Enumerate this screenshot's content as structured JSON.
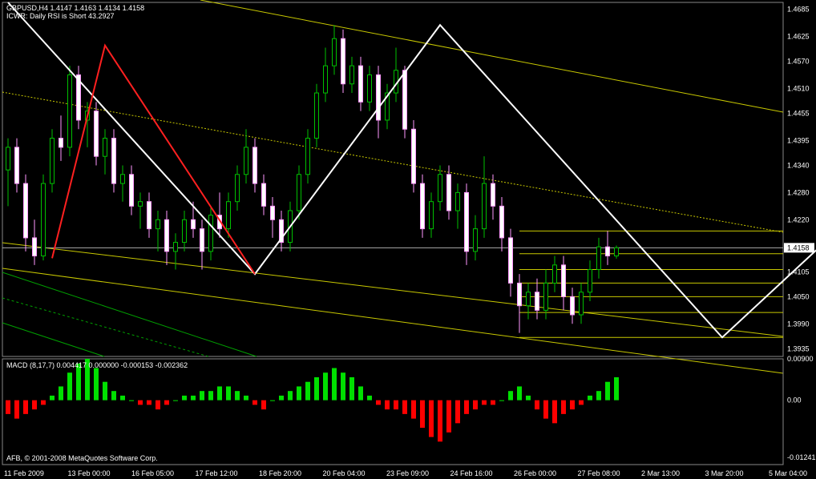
{
  "chart_data": {
    "type": "candlestick",
    "header": {
      "symbol_line": "GBPUSD,H4  1.4147 1.4163 1.4134 1.4158",
      "indicator_line": "ICWR: Daily RSI is Short 43.2927"
    },
    "price_axis": {
      "ylim": [
        1.3918,
        1.47
      ],
      "ticks": [
        "1.4685",
        "1.4625",
        "1.4570",
        "1.4510",
        "1.4455",
        "1.4395",
        "1.4340",
        "1.4280",
        "1.4220",
        "1.4158",
        "1.4105",
        "1.4050",
        "1.3990",
        "1.3935"
      ],
      "current_price": "1.4158"
    },
    "time_axis": {
      "labels": [
        "11 Feb 2009",
        "13 Feb 00:00",
        "16 Feb 05:00",
        "17 Feb 12:00",
        "18 Feb 20:00",
        "20 Feb 04:00",
        "23 Feb 09:00",
        "24 Feb 16:00",
        "26 Feb 00:00",
        "27 Feb 08:00",
        "2 Mar 13:00",
        "3 Mar 20:00",
        "5 Mar 04:00"
      ]
    },
    "zigzag_white": [
      [
        1.47,
        0
      ],
      [
        1.41,
        28
      ],
      [
        1.465,
        49
      ],
      [
        1.396,
        81
      ],
      [
        1.4195,
        94
      ]
    ],
    "zigzag_red": [
      [
        1.4135,
        5
      ],
      [
        1.4605,
        11
      ],
      [
        1.41,
        28
      ]
    ],
    "fib_levels": [
      1.4195,
      1.4145,
      1.411,
      1.408,
      1.405,
      1.4015,
      1.396
    ],
    "candles": [
      [
        1.433,
        1.438,
        1.425,
        1.44
      ],
      [
        1.438,
        1.43,
        1.428,
        1.44
      ],
      [
        1.43,
        1.418,
        1.415,
        1.432
      ],
      [
        1.418,
        1.414,
        1.412,
        1.422
      ],
      [
        1.414,
        1.43,
        1.413,
        1.432
      ],
      [
        1.43,
        1.44,
        1.428,
        1.442
      ],
      [
        1.44,
        1.438,
        1.435,
        1.445
      ],
      [
        1.438,
        1.454,
        1.436,
        1.456
      ],
      [
        1.454,
        1.444,
        1.442,
        1.456
      ],
      [
        1.444,
        1.446,
        1.438,
        1.448
      ],
      [
        1.446,
        1.436,
        1.434,
        1.448
      ],
      [
        1.436,
        1.44,
        1.432,
        1.442
      ],
      [
        1.44,
        1.43,
        1.428,
        1.442
      ],
      [
        1.43,
        1.432,
        1.426,
        1.434
      ],
      [
        1.432,
        1.425,
        1.423,
        1.434
      ],
      [
        1.425,
        1.426,
        1.42,
        1.428
      ],
      [
        1.426,
        1.42,
        1.418,
        1.428
      ],
      [
        1.42,
        1.422,
        1.415,
        1.424
      ],
      [
        1.422,
        1.415,
        1.412,
        1.424
      ],
      [
        1.415,
        1.417,
        1.411,
        1.419
      ],
      [
        1.417,
        1.422,
        1.415,
        1.424
      ],
      [
        1.422,
        1.42,
        1.418,
        1.426
      ],
      [
        1.42,
        1.415,
        1.411,
        1.422
      ],
      [
        1.415,
        1.423,
        1.413,
        1.425
      ],
      [
        1.423,
        1.42,
        1.418,
        1.428
      ],
      [
        1.42,
        1.426,
        1.418,
        1.428
      ],
      [
        1.426,
        1.432,
        1.424,
        1.434
      ],
      [
        1.432,
        1.438,
        1.43,
        1.442
      ],
      [
        1.438,
        1.43,
        1.428,
        1.44
      ],
      [
        1.43,
        1.425,
        1.423,
        1.432
      ],
      [
        1.425,
        1.422,
        1.418,
        1.427
      ],
      [
        1.422,
        1.417,
        1.415,
        1.424
      ],
      [
        1.417,
        1.424,
        1.415,
        1.426
      ],
      [
        1.424,
        1.432,
        1.422,
        1.434
      ],
      [
        1.432,
        1.44,
        1.43,
        1.442
      ],
      [
        1.44,
        1.45,
        1.438,
        1.452
      ],
      [
        1.45,
        1.456,
        1.448,
        1.46
      ],
      [
        1.456,
        1.462,
        1.454,
        1.465
      ],
      [
        1.462,
        1.452,
        1.45,
        1.464
      ],
      [
        1.452,
        1.456,
        1.45,
        1.458
      ],
      [
        1.456,
        1.448,
        1.446,
        1.458
      ],
      [
        1.448,
        1.454,
        1.446,
        1.456
      ],
      [
        1.454,
        1.444,
        1.44,
        1.456
      ],
      [
        1.444,
        1.45,
        1.442,
        1.452
      ],
      [
        1.45,
        1.455,
        1.448,
        1.46
      ],
      [
        1.455,
        1.442,
        1.44,
        1.456
      ],
      [
        1.442,
        1.43,
        1.428,
        1.444
      ],
      [
        1.43,
        1.42,
        1.418,
        1.432
      ],
      [
        1.42,
        1.426,
        1.418,
        1.428
      ],
      [
        1.426,
        1.432,
        1.424,
        1.434
      ],
      [
        1.432,
        1.424,
        1.422,
        1.434
      ],
      [
        1.424,
        1.428,
        1.42,
        1.43
      ],
      [
        1.428,
        1.415,
        1.412,
        1.43
      ],
      [
        1.415,
        1.42,
        1.413,
        1.423
      ],
      [
        1.42,
        1.43,
        1.418,
        1.436
      ],
      [
        1.43,
        1.425,
        1.422,
        1.432
      ],
      [
        1.425,
        1.418,
        1.415,
        1.427
      ],
      [
        1.418,
        1.408,
        1.405,
        1.42
      ],
      [
        1.408,
        1.403,
        1.397,
        1.41
      ],
      [
        1.403,
        1.406,
        1.4,
        1.408
      ],
      [
        1.406,
        1.402,
        1.4,
        1.409
      ],
      [
        1.402,
        1.408,
        1.4,
        1.411
      ],
      [
        1.408,
        1.412,
        1.406,
        1.414
      ],
      [
        1.412,
        1.405,
        1.402,
        1.414
      ],
      [
        1.405,
        1.401,
        1.399,
        1.407
      ],
      [
        1.401,
        1.406,
        1.399,
        1.408
      ],
      [
        1.406,
        1.411,
        1.404,
        1.413
      ],
      [
        1.411,
        1.416,
        1.409,
        1.418
      ],
      [
        1.416,
        1.414,
        1.412,
        1.4195
      ],
      [
        1.414,
        1.4158,
        1.4134,
        1.4163
      ]
    ],
    "macd": {
      "label": "MACD (8,17,7) 0.004417 0.000000 -0.000153 -0.002362",
      "ylim": [
        -0.014,
        0.009
      ],
      "ticks": [
        "0.00900",
        "0.00",
        "-0.01241"
      ],
      "histogram": [
        -0.003,
        -0.004,
        -0.003,
        -0.002,
        -0.001,
        0.001,
        0.003,
        0.006,
        0.008,
        0.009,
        0.007,
        0.004,
        0.002,
        0.001,
        0.0,
        -0.001,
        -0.001,
        -0.002,
        -0.001,
        0.0,
        0.001,
        0.001,
        0.002,
        0.002,
        0.003,
        0.003,
        0.002,
        0.001,
        -0.001,
        -0.002,
        0.0,
        0.001,
        0.002,
        0.003,
        0.004,
        0.005,
        0.006,
        0.007,
        0.006,
        0.005,
        0.003,
        0.001,
        -0.001,
        -0.002,
        -0.002,
        -0.003,
        -0.004,
        -0.006,
        -0.008,
        -0.009,
        -0.007,
        -0.005,
        -0.003,
        -0.002,
        -0.001,
        -0.001,
        0.0,
        0.002,
        0.003,
        0.001,
        -0.002,
        -0.004,
        -0.005,
        -0.003,
        -0.002,
        -0.001,
        0.001,
        0.002,
        0.004,
        0.005
      ]
    },
    "footer_text": "AFB, © 2001-2008 MetaQuotes Software Corp."
  }
}
